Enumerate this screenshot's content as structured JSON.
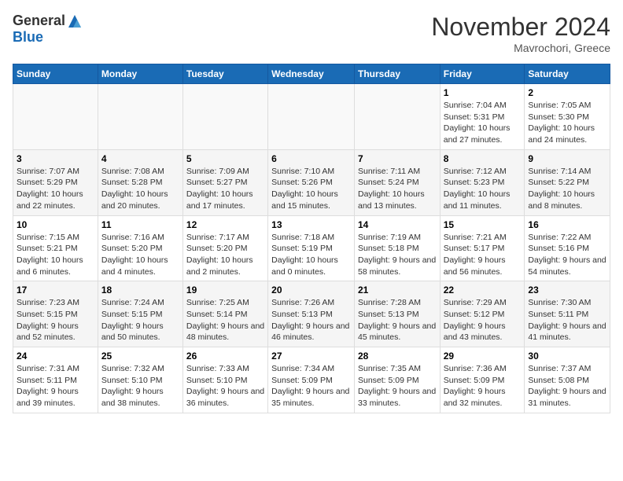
{
  "header": {
    "logo_general": "General",
    "logo_blue": "Blue",
    "month": "November 2024",
    "location": "Mavrochori, Greece"
  },
  "weekdays": [
    "Sunday",
    "Monday",
    "Tuesday",
    "Wednesday",
    "Thursday",
    "Friday",
    "Saturday"
  ],
  "weeks": [
    [
      {
        "day": "",
        "info": ""
      },
      {
        "day": "",
        "info": ""
      },
      {
        "day": "",
        "info": ""
      },
      {
        "day": "",
        "info": ""
      },
      {
        "day": "",
        "info": ""
      },
      {
        "day": "1",
        "info": "Sunrise: 7:04 AM\nSunset: 5:31 PM\nDaylight: 10 hours and 27 minutes."
      },
      {
        "day": "2",
        "info": "Sunrise: 7:05 AM\nSunset: 5:30 PM\nDaylight: 10 hours and 24 minutes."
      }
    ],
    [
      {
        "day": "3",
        "info": "Sunrise: 7:07 AM\nSunset: 5:29 PM\nDaylight: 10 hours and 22 minutes."
      },
      {
        "day": "4",
        "info": "Sunrise: 7:08 AM\nSunset: 5:28 PM\nDaylight: 10 hours and 20 minutes."
      },
      {
        "day": "5",
        "info": "Sunrise: 7:09 AM\nSunset: 5:27 PM\nDaylight: 10 hours and 17 minutes."
      },
      {
        "day": "6",
        "info": "Sunrise: 7:10 AM\nSunset: 5:26 PM\nDaylight: 10 hours and 15 minutes."
      },
      {
        "day": "7",
        "info": "Sunrise: 7:11 AM\nSunset: 5:24 PM\nDaylight: 10 hours and 13 minutes."
      },
      {
        "day": "8",
        "info": "Sunrise: 7:12 AM\nSunset: 5:23 PM\nDaylight: 10 hours and 11 minutes."
      },
      {
        "day": "9",
        "info": "Sunrise: 7:14 AM\nSunset: 5:22 PM\nDaylight: 10 hours and 8 minutes."
      }
    ],
    [
      {
        "day": "10",
        "info": "Sunrise: 7:15 AM\nSunset: 5:21 PM\nDaylight: 10 hours and 6 minutes."
      },
      {
        "day": "11",
        "info": "Sunrise: 7:16 AM\nSunset: 5:20 PM\nDaylight: 10 hours and 4 minutes."
      },
      {
        "day": "12",
        "info": "Sunrise: 7:17 AM\nSunset: 5:20 PM\nDaylight: 10 hours and 2 minutes."
      },
      {
        "day": "13",
        "info": "Sunrise: 7:18 AM\nSunset: 5:19 PM\nDaylight: 10 hours and 0 minutes."
      },
      {
        "day": "14",
        "info": "Sunrise: 7:19 AM\nSunset: 5:18 PM\nDaylight: 9 hours and 58 minutes."
      },
      {
        "day": "15",
        "info": "Sunrise: 7:21 AM\nSunset: 5:17 PM\nDaylight: 9 hours and 56 minutes."
      },
      {
        "day": "16",
        "info": "Sunrise: 7:22 AM\nSunset: 5:16 PM\nDaylight: 9 hours and 54 minutes."
      }
    ],
    [
      {
        "day": "17",
        "info": "Sunrise: 7:23 AM\nSunset: 5:15 PM\nDaylight: 9 hours and 52 minutes."
      },
      {
        "day": "18",
        "info": "Sunrise: 7:24 AM\nSunset: 5:15 PM\nDaylight: 9 hours and 50 minutes."
      },
      {
        "day": "19",
        "info": "Sunrise: 7:25 AM\nSunset: 5:14 PM\nDaylight: 9 hours and 48 minutes."
      },
      {
        "day": "20",
        "info": "Sunrise: 7:26 AM\nSunset: 5:13 PM\nDaylight: 9 hours and 46 minutes."
      },
      {
        "day": "21",
        "info": "Sunrise: 7:28 AM\nSunset: 5:13 PM\nDaylight: 9 hours and 45 minutes."
      },
      {
        "day": "22",
        "info": "Sunrise: 7:29 AM\nSunset: 5:12 PM\nDaylight: 9 hours and 43 minutes."
      },
      {
        "day": "23",
        "info": "Sunrise: 7:30 AM\nSunset: 5:11 PM\nDaylight: 9 hours and 41 minutes."
      }
    ],
    [
      {
        "day": "24",
        "info": "Sunrise: 7:31 AM\nSunset: 5:11 PM\nDaylight: 9 hours and 39 minutes."
      },
      {
        "day": "25",
        "info": "Sunrise: 7:32 AM\nSunset: 5:10 PM\nDaylight: 9 hours and 38 minutes."
      },
      {
        "day": "26",
        "info": "Sunrise: 7:33 AM\nSunset: 5:10 PM\nDaylight: 9 hours and 36 minutes."
      },
      {
        "day": "27",
        "info": "Sunrise: 7:34 AM\nSunset: 5:09 PM\nDaylight: 9 hours and 35 minutes."
      },
      {
        "day": "28",
        "info": "Sunrise: 7:35 AM\nSunset: 5:09 PM\nDaylight: 9 hours and 33 minutes."
      },
      {
        "day": "29",
        "info": "Sunrise: 7:36 AM\nSunset: 5:09 PM\nDaylight: 9 hours and 32 minutes."
      },
      {
        "day": "30",
        "info": "Sunrise: 7:37 AM\nSunset: 5:08 PM\nDaylight: 9 hours and 31 minutes."
      }
    ]
  ]
}
